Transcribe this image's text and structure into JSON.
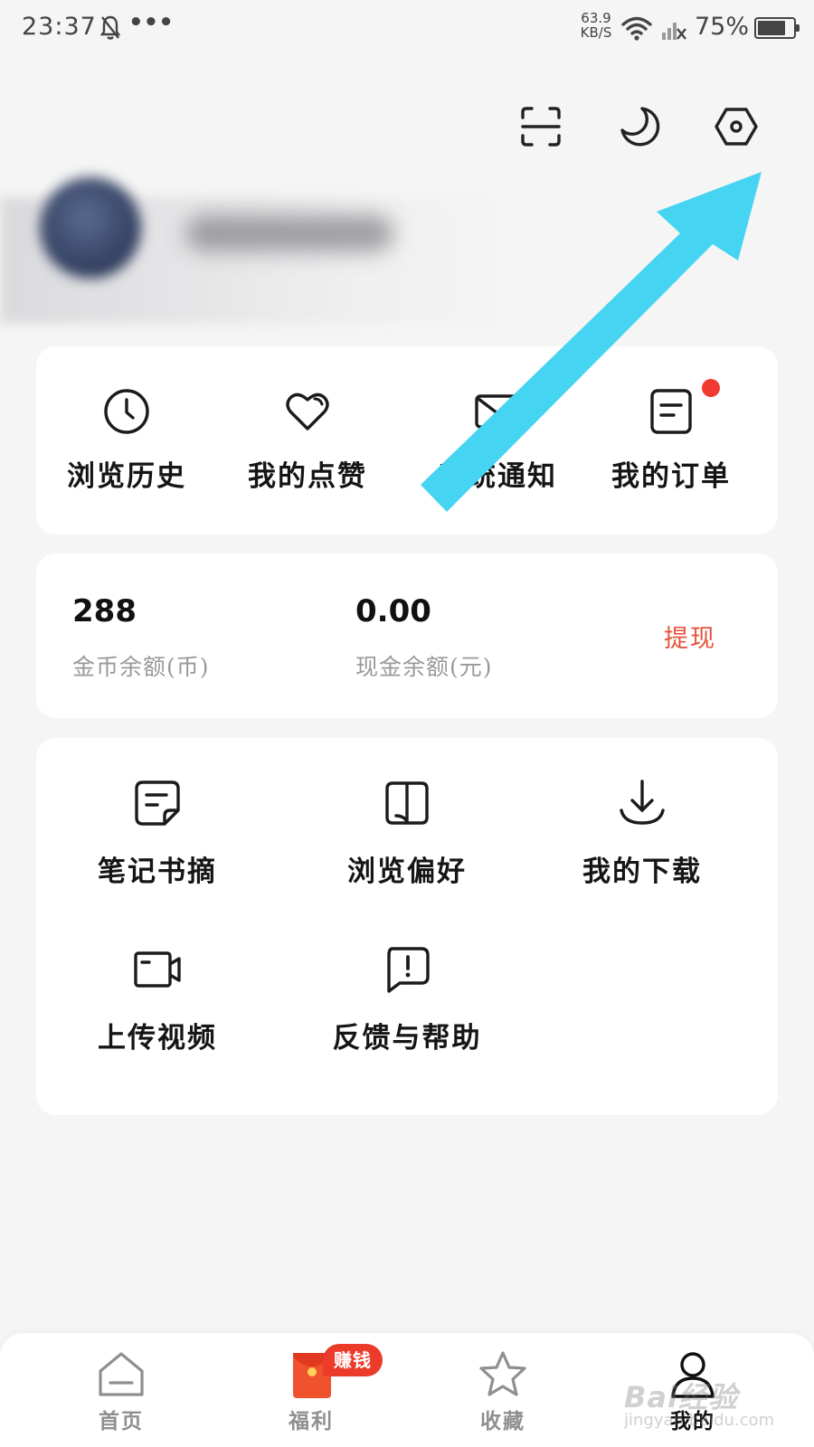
{
  "status_bar": {
    "time": "23:37",
    "dots": "•••",
    "net_speed_value": "63.9",
    "net_speed_unit": "KB/S",
    "battery_text": "75%"
  },
  "top_tools": [
    {
      "icon": "scan-icon"
    },
    {
      "icon": "moon-icon"
    },
    {
      "icon": "settings-icon"
    }
  ],
  "quick_actions": [
    {
      "label": "浏览历史",
      "icon": "clock-icon"
    },
    {
      "label": "我的点赞",
      "icon": "heart-icon"
    },
    {
      "label": "系统通知",
      "icon": "mail-icon"
    },
    {
      "label": "我的订单",
      "icon": "order-icon",
      "has_dot": true
    }
  ],
  "wallet": {
    "coins_value": "288",
    "coins_label": "金币余额(币)",
    "cash_value": "0.00",
    "cash_label": "现金余额(元)",
    "withdraw_label": "提现"
  },
  "tools": [
    {
      "label": "笔记书摘",
      "icon": "note-icon"
    },
    {
      "label": "浏览偏好",
      "icon": "book-icon"
    },
    {
      "label": "我的下载",
      "icon": "download-icon"
    },
    {
      "label": "上传视频",
      "icon": "video-icon"
    },
    {
      "label": "反馈与帮助",
      "icon": "feedback-icon"
    }
  ],
  "bottom_nav": {
    "items": [
      {
        "label": "首页",
        "icon": "home-icon"
      },
      {
        "label": "福利",
        "icon": "red-packet-icon",
        "badge": "赚钱"
      },
      {
        "label": "收藏",
        "icon": "star-icon"
      },
      {
        "label": "我的",
        "icon": "person-icon",
        "active": true
      }
    ]
  },
  "watermark": {
    "brand": "Bai经验",
    "url": "jingyan.baidu.com"
  },
  "colors": {
    "accent_red": "#ec3b2b",
    "withdraw": "#e5533c",
    "arrow": "#45d4f2"
  }
}
